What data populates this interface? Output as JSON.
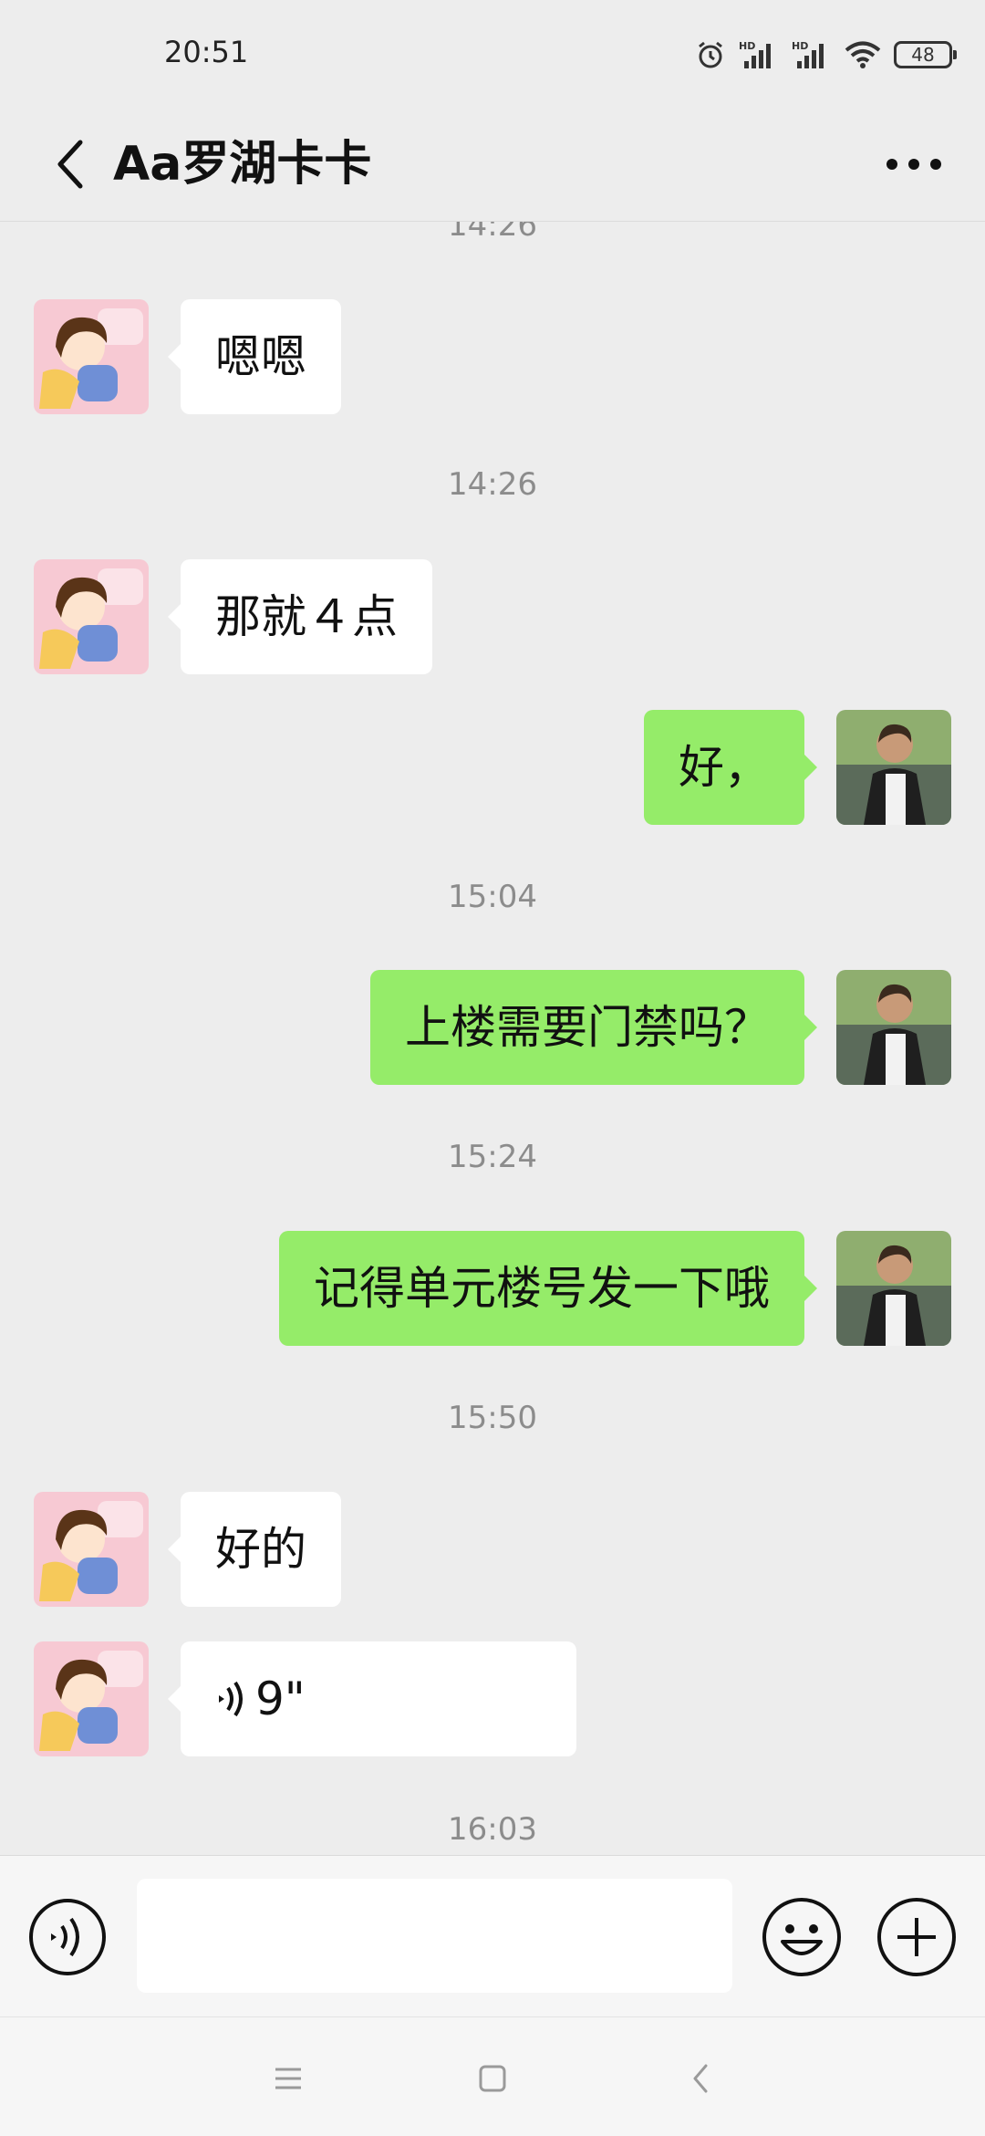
{
  "status_bar": {
    "time": "20:51",
    "battery": "48",
    "icons": [
      "alarm-icon",
      "signal-hd-icon",
      "signal-hd-icon",
      "wifi-icon",
      "battery-icon"
    ]
  },
  "header": {
    "title": "Aa罗湖卡卡",
    "back_icon": "back-arrow-icon",
    "more_icon": "more-icon"
  },
  "messages": [
    {
      "type": "time",
      "text": "14:26"
    },
    {
      "type": "message",
      "sender": "contact",
      "text": "嗯嗯"
    },
    {
      "type": "time",
      "text": "14:26"
    },
    {
      "type": "message",
      "sender": "contact",
      "text": "那就４点"
    },
    {
      "type": "message",
      "sender": "me",
      "text": "好，"
    },
    {
      "type": "time",
      "text": "15:04"
    },
    {
      "type": "message",
      "sender": "me",
      "text": "上楼需要门禁吗？"
    },
    {
      "type": "time",
      "text": "15:24"
    },
    {
      "type": "message",
      "sender": "me",
      "text": "记得单元楼号发一下哦"
    },
    {
      "type": "time",
      "text": "15:50"
    },
    {
      "type": "message",
      "sender": "contact",
      "text": "好的"
    },
    {
      "type": "voice",
      "sender": "contact",
      "duration": "9\""
    },
    {
      "type": "time",
      "text": "16:03"
    }
  ],
  "input_bar": {
    "voice_icon": "voice-input-icon",
    "text_value": "",
    "emoji_icon": "emoji-icon",
    "plus_icon": "plus-icon"
  },
  "nav_bar": {
    "icons": [
      "menu-icon",
      "home-icon",
      "back-icon"
    ]
  },
  "colors": {
    "background": "#ededed",
    "outgoing_bubble": "#95ec69",
    "incoming_bubble": "#ffffff"
  }
}
